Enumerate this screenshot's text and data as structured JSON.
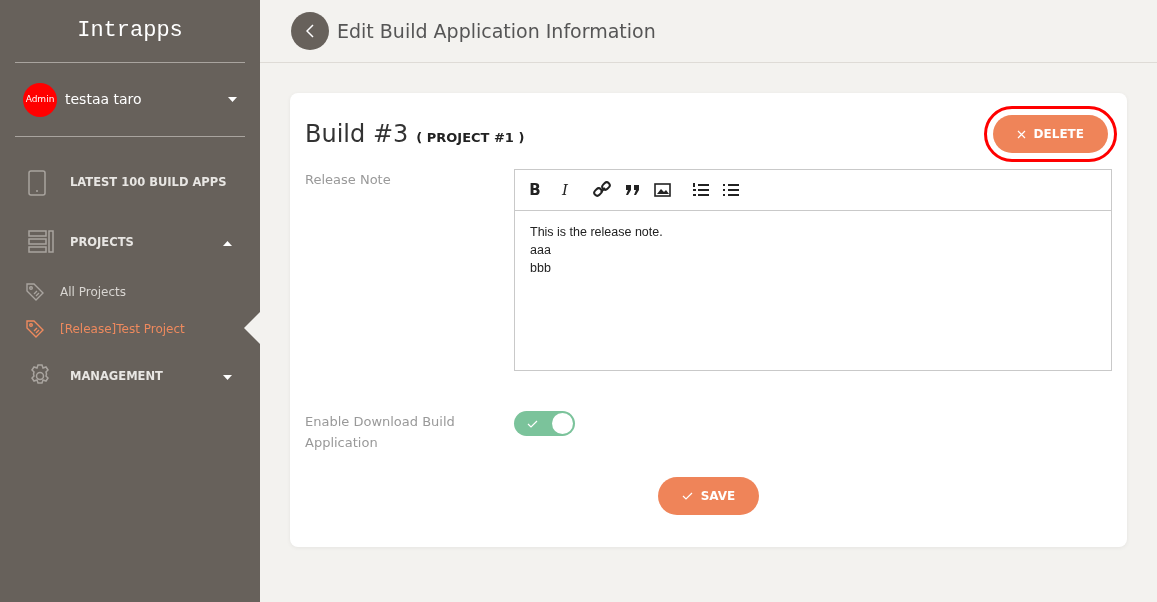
{
  "sidebar": {
    "brand": "Intrapps",
    "user": {
      "badge": "Admin",
      "name": "testaa taro"
    },
    "items": [
      {
        "kind": "section",
        "label": "LATEST 100 BUILD APPS"
      },
      {
        "kind": "section",
        "label": "PROJECTS",
        "expanded": true,
        "children": [
          {
            "label": "All Projects",
            "selected": false
          },
          {
            "label": "[Release]Test Project",
            "selected": true
          }
        ]
      },
      {
        "kind": "section",
        "label": "MANAGEMENT",
        "expanded": false
      }
    ]
  },
  "header": {
    "title": "Edit Build Application Information"
  },
  "form": {
    "title": "Build #3",
    "subtitle": "( PROJECT #1 )",
    "delete_button": {
      "label": "DELETE",
      "highlighted": true
    },
    "release_note": {
      "label": "Release Note",
      "toolbar": [
        [
          {
            "kind": "bold",
            "label": "B"
          },
          {
            "kind": "italic",
            "label": "I"
          }
        ],
        [
          {
            "kind": "link"
          },
          {
            "kind": "quote"
          },
          {
            "kind": "image"
          }
        ],
        [
          {
            "kind": "ordered"
          },
          {
            "kind": "bullets"
          }
        ]
      ],
      "lines": [
        "This is the release note.",
        "aaa",
        "bbb"
      ]
    },
    "download_toggle": {
      "label": "Enable Download Build Application",
      "on": true
    },
    "save_button": {
      "label": "SAVE"
    }
  }
}
